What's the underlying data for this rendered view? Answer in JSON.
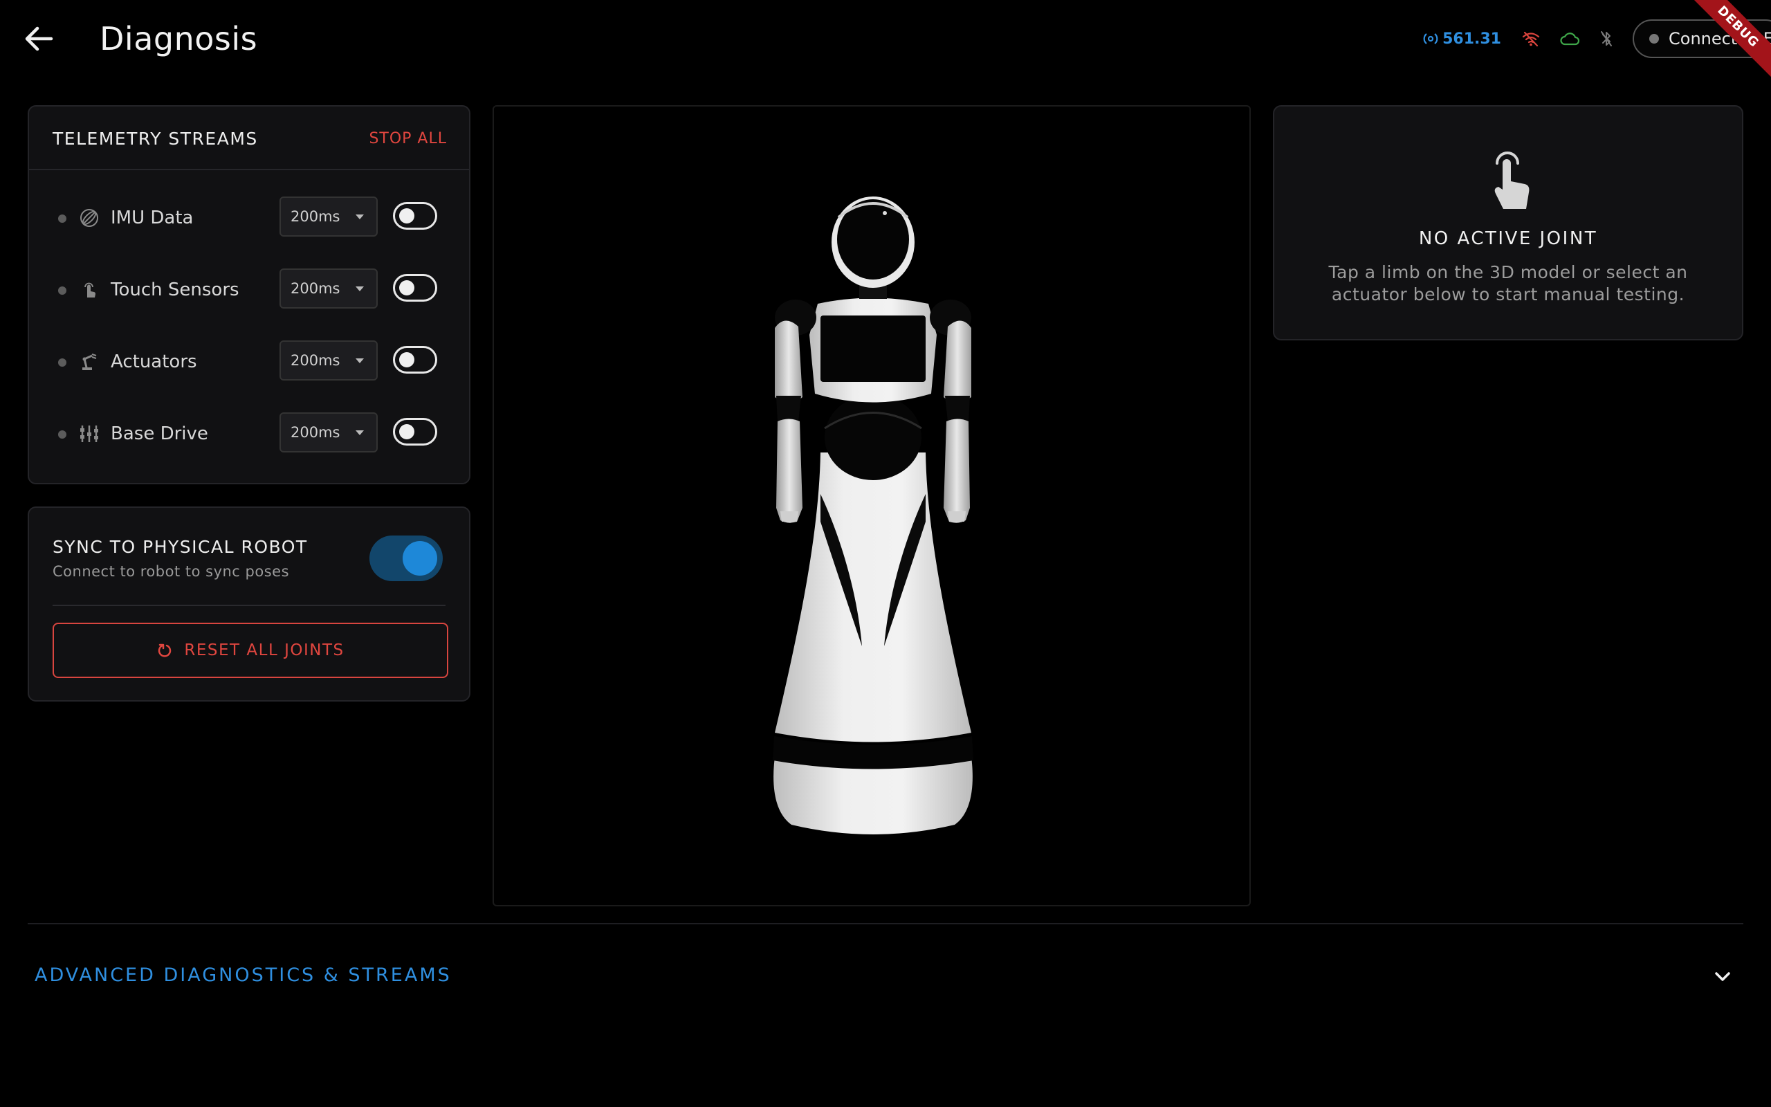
{
  "header": {
    "title": "Diagnosis",
    "signal_value": "561.31",
    "connect_label": "Connect BLE",
    "debug_label": "DEBUG"
  },
  "telemetry": {
    "title": "TELEMETRY STREAMS",
    "stop_all_label": "STOP ALL",
    "streams": [
      {
        "label": "IMU Data",
        "interval": "200ms",
        "icon": "gyroscope-icon",
        "enabled": false
      },
      {
        "label": "Touch Sensors",
        "interval": "200ms",
        "icon": "touch-icon",
        "enabled": false
      },
      {
        "label": "Actuators",
        "interval": "200ms",
        "icon": "robot-arm-icon",
        "enabled": false
      },
      {
        "label": "Base Drive",
        "interval": "200ms",
        "icon": "wheels-icon",
        "enabled": false
      }
    ]
  },
  "sync": {
    "title": "SYNC TO PHYSICAL ROBOT",
    "subtitle": "Connect to robot to sync poses",
    "enabled": true,
    "reset_label": "RESET ALL JOINTS"
  },
  "joint_panel": {
    "title": "NO ACTIVE JOINT",
    "description": "Tap a limb on the 3D model or select an actuator below to start manual testing."
  },
  "advanced": {
    "label": "ADVANCED DIAGNOSTICS & STREAMS"
  },
  "colors": {
    "accent_blue": "#2f8fe0",
    "danger_red": "#e0463f",
    "wifi_status": "#d9443d",
    "cloud_status": "#3fa74a",
    "card_bg": "#111113"
  }
}
